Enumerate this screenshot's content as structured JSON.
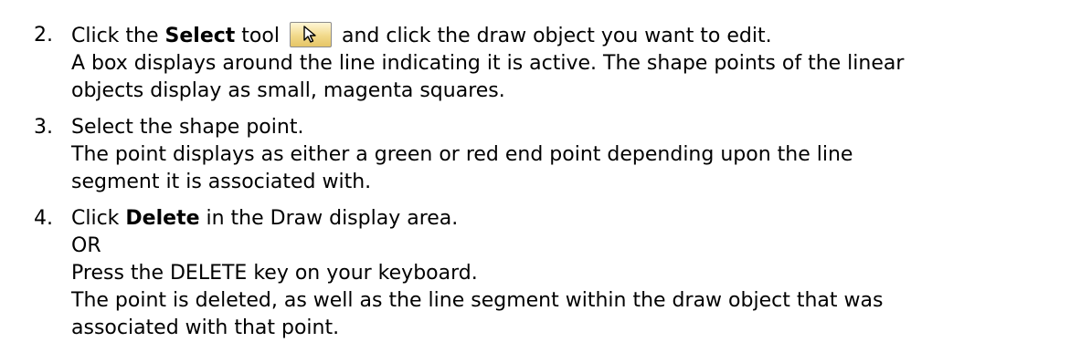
{
  "steps": [
    {
      "number": "2.",
      "pre": "Click the ",
      "bold": "Select",
      "mid": " tool",
      "post": " and click the draw object you want to edit.",
      "line2": "A box displays around the line indicating it is active. The shape points of the linear",
      "line3": "objects display as small, magenta squares.",
      "tool_icon": "select-arrow-icon"
    },
    {
      "number": "3.",
      "line1": "Select the shape point.",
      "line2": "The point displays as either a green or red end point depending upon the line",
      "line3": "segment it is associated with."
    },
    {
      "number": "4.",
      "pre": "Click ",
      "bold": "Delete",
      "post": " in the Draw display area.",
      "line2": "OR",
      "line3": "Press the DELETE key on your keyboard.",
      "line4": "The point is deleted, as well as the line segment within the draw object that was",
      "line5": "associated with that point."
    }
  ]
}
